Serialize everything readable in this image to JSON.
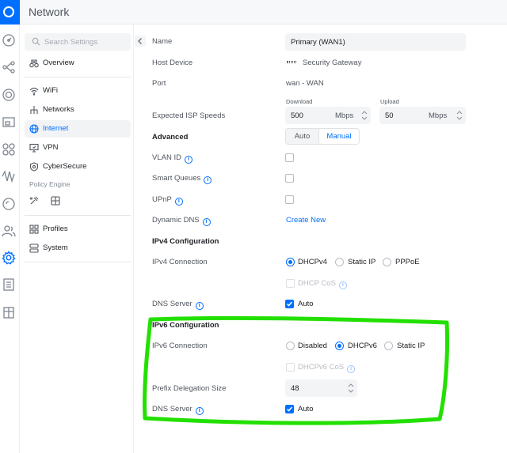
{
  "app": {
    "title": "Network"
  },
  "rail": {
    "icons": [
      "dashboard-icon",
      "topology-icon",
      "devices-icon",
      "monitor-icon",
      "clients-icon",
      "insights-icon",
      "radius-icon",
      "users-icon",
      "settings-icon",
      "logs-icon",
      "gift-icon"
    ]
  },
  "sidebar": {
    "search_placeholder": "Search Settings",
    "items": [
      {
        "label": "Overview",
        "icon": "binoculars-icon"
      },
      {
        "label": "WiFi",
        "icon": "wifi-icon"
      },
      {
        "label": "Networks",
        "icon": "networks-icon"
      },
      {
        "label": "Internet",
        "icon": "globe-icon",
        "active": true
      },
      {
        "label": "VPN",
        "icon": "vpn-icon"
      },
      {
        "label": "CyberSecure",
        "icon": "shield-icon"
      },
      {
        "label": "Profiles",
        "icon": "profiles-icon"
      },
      {
        "label": "System",
        "icon": "system-icon"
      }
    ],
    "policy_engine_label": "Policy Engine"
  },
  "form": {
    "name": {
      "label": "Name",
      "value": "Primary (WAN1)"
    },
    "host_device": {
      "label": "Host Device",
      "value": "Security Gateway"
    },
    "port": {
      "label": "Port",
      "value": "wan - WAN"
    },
    "isp_speeds": {
      "label": "Expected ISP Speeds",
      "download_caption": "Download",
      "download_value": "500",
      "download_unit": "Mbps",
      "upload_caption": "Upload",
      "upload_value": "50",
      "upload_unit": "Mbps"
    },
    "advanced": {
      "label": "Advanced",
      "options": [
        "Auto",
        "Manual"
      ],
      "selected": "Manual"
    },
    "vlan_id": {
      "label": "VLAN ID"
    },
    "smart_queues": {
      "label": "Smart Queues"
    },
    "upnp": {
      "label": "UPnP"
    },
    "dynamic_dns": {
      "label": "Dynamic DNS",
      "action": "Create New"
    },
    "ipv4_heading": "IPv4 Configuration",
    "ipv4_connection": {
      "label": "IPv4 Connection",
      "options": [
        "DHCPv4",
        "Static IP",
        "PPPoE"
      ],
      "selected": "DHCPv4"
    },
    "dhcp_cos": {
      "label": "DHCP CoS"
    },
    "ipv4_dns": {
      "label": "DNS Server",
      "option": "Auto"
    },
    "ipv6_heading": "IPv6 Configuration",
    "ipv6_connection": {
      "label": "IPv6 Connection",
      "options": [
        "Disabled",
        "DHCPv6",
        "Static IP"
      ],
      "selected": "DHCPv6"
    },
    "dhcpv6_cos": {
      "label": "DHCPv6 CoS"
    },
    "prefix_delegation": {
      "label": "Prefix Delegation Size",
      "value": "48"
    },
    "ipv6_dns": {
      "label": "DNS Server",
      "option": "Auto"
    }
  },
  "colors": {
    "accent": "#006fff",
    "highlight": "#22e000"
  }
}
